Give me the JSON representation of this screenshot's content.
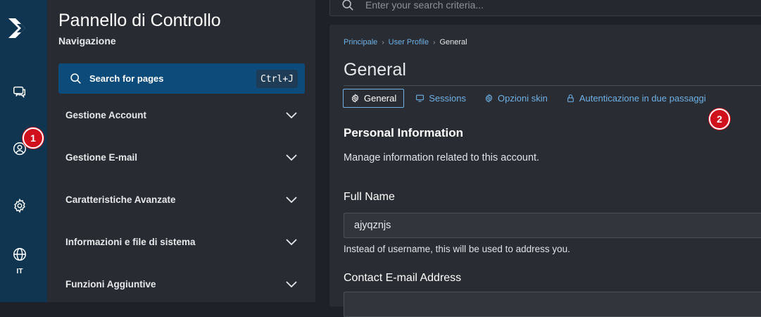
{
  "rail": {
    "language": "IT"
  },
  "badges": {
    "first": "1",
    "second": "2"
  },
  "nav": {
    "title": "Pannello di Controllo",
    "subtitle": "Navigazione",
    "search_label": "Search for pages",
    "search_shortcut": "Ctrl+J",
    "items": [
      {
        "label": "Gestione Account"
      },
      {
        "label": "Gestione E-mail"
      },
      {
        "label": "Caratteristiche Avanzate"
      },
      {
        "label": "Informazioni e file di sistema"
      },
      {
        "label": "Funzioni Aggiuntive"
      }
    ]
  },
  "topbar": {
    "search_placeholder": "Enter your search criteria..."
  },
  "main": {
    "breadcrumb": [
      "Principale",
      "User Profile",
      "General"
    ],
    "title": "General",
    "tabs": [
      {
        "label": "General",
        "icon": "gear-icon",
        "active": true
      },
      {
        "label": "Sessions",
        "icon": "monitor-icon",
        "active": false
      },
      {
        "label": "Opzioni skin",
        "icon": "gear-icon",
        "active": false
      },
      {
        "label": "Autenticazione in due passaggi",
        "icon": "lock-icon",
        "active": false
      }
    ],
    "section_title": "Personal Information",
    "section_desc": "Manage information related to this account.",
    "full_name_label": "Full Name",
    "full_name_value": "ajyqznjs",
    "full_name_help": "Instead of username, this will be used to address you.",
    "email_label": "Contact E-mail Address"
  },
  "colors": {
    "rail_bg": "#0f3550",
    "accent": "#6fb1e6",
    "badge": "#d0101c"
  }
}
